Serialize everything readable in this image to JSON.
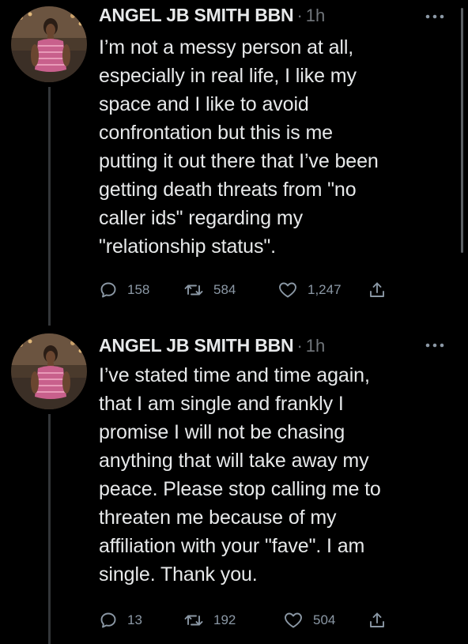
{
  "tweets": [
    {
      "author": "ANGEL JB SMITH BBN",
      "separator": "·",
      "time": "1h",
      "text": "I’m not a messy person at all,\nespecially in real life, I like my\nspace and I like to avoid\nconfrontation but this is me\nputting it out there that I’ve been\ngetting death threats from \"no\ncaller ids\" regarding my\n\"relationship status\".",
      "replies": "158",
      "retweets": "584",
      "likes": "1,247"
    },
    {
      "author": "ANGEL JB SMITH BBN",
      "separator": "·",
      "time": "1h",
      "text": "I’ve stated time and time again,\nthat I am single and frankly I\npromise I will not be chasing\nanything that will take away my\npeace. Please stop calling me to\nthreaten me because of my\naffiliation with your \"fave\". I am\nsingle. Thank you.",
      "replies": "13",
      "retweets": "192",
      "likes": "504"
    }
  ],
  "icons": {
    "reply": "reply-icon",
    "retweet": "retweet-icon",
    "like": "heart-icon",
    "share": "share-icon",
    "more": "more-icon"
  },
  "colors": {
    "background": "#000000",
    "text": "#e7e9ea",
    "muted": "#71767b",
    "icon": "#8b98a5"
  }
}
